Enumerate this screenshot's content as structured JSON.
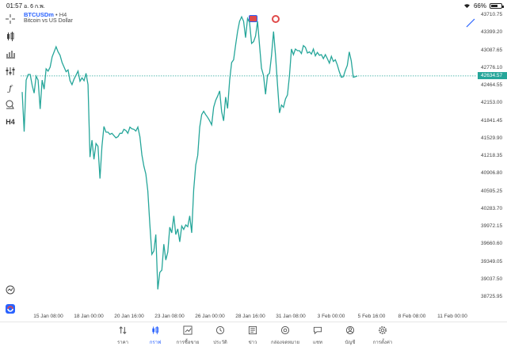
{
  "status_bar": {
    "time": "01:57",
    "date": "อ. 6 ก.พ.",
    "battery": "66%",
    "battery_level": 0.66
  },
  "chart": {
    "symbol": "BTCUSDm",
    "timeframe": "• H4",
    "description": "Bitcoin vs US Dollar",
    "line_color": "#26a69a",
    "current_price": "42634.57"
  },
  "toolbar": {
    "icons": [
      "crosshair-icon",
      "candlestick-icon",
      "bar-chart-icon",
      "indicators-icon",
      "function-icon",
      "objects-icon"
    ],
    "timeframe_label": "H4"
  },
  "chart_data": {
    "type": "line",
    "yticks": [
      "43710.75",
      "43399.20",
      "43087.65",
      "42776.10",
      "42464.55",
      "42153.00",
      "41841.45",
      "41529.90",
      "41218.35",
      "40906.80",
      "40595.25",
      "40283.70",
      "39972.15",
      "39660.60",
      "39349.05",
      "39037.50",
      "38725.95"
    ],
    "xticks": [
      "15 Jan 08:00",
      "18 Jan 00:00",
      "20 Jan 16:00",
      "23 Jan 08:00",
      "26 Jan 00:00",
      "28 Jan 16:00",
      "31 Jan 08:00",
      "3 Feb 00:00",
      "5 Feb 16:00",
      "8 Feb 08:00",
      "11 Feb 00:00"
    ],
    "ylim": [
      38725.95,
      43710.75
    ],
    "values": [
      42350,
      41650,
      42560,
      42660,
      42660,
      42470,
      42330,
      42630,
      42560,
      42050,
      42560,
      42400,
      42760,
      42720,
      42790,
      42970,
      43060,
      43150,
      43060,
      43000,
      42870,
      42790,
      42710,
      42740,
      42550,
      42480,
      42580,
      42650,
      42720,
      42540,
      42600,
      42550,
      42680,
      42480,
      41200,
      41500,
      41160,
      41440,
      41390,
      40820,
      41390,
      41740,
      41640,
      41640,
      41600,
      41620,
      41580,
      41540,
      41560,
      41620,
      41620,
      41690,
      41670,
      41620,
      41730,
      41700,
      41690,
      41660,
      41730,
      41560,
      41240,
      41040,
      40900,
      40600,
      40020,
      39480,
      39540,
      39830,
      38860,
      39160,
      39200,
      39660,
      39380,
      39520,
      39960,
      39860,
      40160,
      39830,
      39930,
      39700,
      39980,
      39920,
      40000,
      39970,
      40160,
      39860,
      40620,
      41060,
      41230,
      41730,
      41950,
      42010,
      41950,
      41900,
      41840,
      41770,
      42080,
      42200,
      42280,
      42370,
      42000,
      41840,
      42260,
      42060,
      42560,
      42870,
      42920,
      43180,
      43420,
      43600,
      43680,
      43600,
      43310,
      43650,
      43580,
      43210,
      43240,
      43340,
      43600,
      43180,
      42770,
      42640,
      42310,
      42650,
      42680,
      42990,
      43420,
      43000,
      42480,
      41980,
      42120,
      42080,
      42230,
      42300,
      42640,
      43110,
      43010,
      43110,
      43080,
      43080,
      43030,
      43170,
      43140,
      43040,
      43060,
      43020,
      43110,
      42990,
      43050,
      43000,
      43010,
      42940,
      43010,
      42940,
      42860,
      42980,
      42890,
      42920,
      42830,
      42710,
      42610,
      42620,
      42730,
      42820,
      43060,
      42900,
      42610,
      42620,
      42634.57
    ],
    "current_price": 42634.57
  },
  "bottom_nav": [
    {
      "label": "ราคา",
      "icon": "sort-arrows-icon",
      "active": false
    },
    {
      "label": "กราฟ",
      "icon": "candlestick-icon",
      "active": true
    },
    {
      "label": "การซื้อขาย",
      "icon": "trend-chart-icon",
      "active": false
    },
    {
      "label": "ประวัติ",
      "icon": "history-icon",
      "active": false
    },
    {
      "label": "ข่าว",
      "icon": "news-icon",
      "active": false
    },
    {
      "label": "กล่องจดหมาย",
      "icon": "mailbox-at-icon",
      "active": false
    },
    {
      "label": "แชท",
      "icon": "chat-icon",
      "active": false
    },
    {
      "label": "บัญชี",
      "icon": "account-icon",
      "active": false
    },
    {
      "label": "การตั้งค่า",
      "icon": "settings-gear-icon",
      "active": false
    }
  ]
}
